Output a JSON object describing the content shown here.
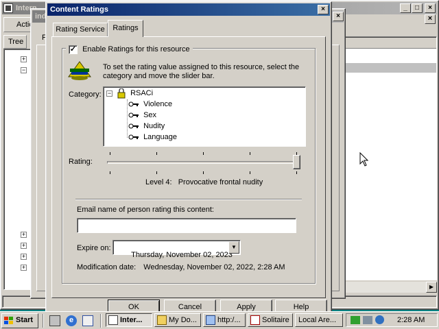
{
  "bg_window": {
    "title": "Intern",
    "menu_action": "Action",
    "tree_tab": "Tree"
  },
  "mid_window": {
    "title": "ind",
    "letter": "F"
  },
  "dialog": {
    "title": "Content Ratings",
    "tabs": [
      "Rating Service",
      "Ratings"
    ],
    "active_tab": "Ratings",
    "enable_checked": true,
    "enable_label": "Enable Ratings for this resource",
    "instruction": "To set the rating value assigned to this resource, select the category and move the slider bar.",
    "category_label": "Category:",
    "tree_root": "RSACi",
    "tree_items": [
      "Violence",
      "Sex",
      "Nudity",
      "Language"
    ],
    "rating_label": "Rating:",
    "rating_level": 4,
    "rating_max": 4,
    "level_text": "Level 4:   Provocative frontal nudity",
    "email_label": "Email name of person rating this content:",
    "email_value": "",
    "expire_label": "Expire on:",
    "expire_day": "Thursday",
    "expire_date": ", November 02, 2023",
    "mod_label": "Modification date:",
    "mod_value": "Wednesday, November 02, 2022, 2:28 AM",
    "buttons": {
      "ok": "OK",
      "cancel": "Cancel",
      "apply": "Apply",
      "help": "Help"
    }
  },
  "taskbar": {
    "start": "Start",
    "tasks": [
      "Inter...",
      "My Do...",
      "http:/...",
      "Solitaire",
      "Local Are..."
    ],
    "clock": "2:28 AM"
  },
  "colors": {
    "desktop": "#008080",
    "face": "#d4d0c8",
    "title_active": "#0a246a",
    "title_inactive": "#808080"
  }
}
